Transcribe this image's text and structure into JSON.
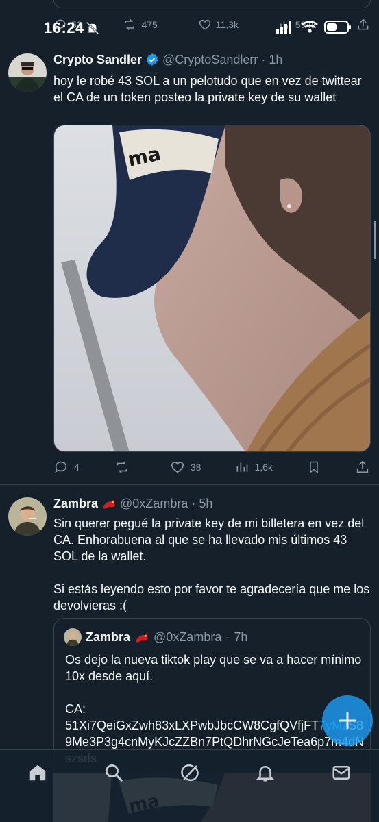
{
  "status_bar": {
    "time": "16:24"
  },
  "previous_tweet": {
    "reply_count": "52",
    "retweet_count": "475",
    "like_count": "11,3k",
    "view_count": "594k"
  },
  "tweet1": {
    "author_name": "Crypto Sandler",
    "handle": "@CryptoSandlerr",
    "time": "1h",
    "text": "hoy le robé 43 SOL a un pelotudo que en vez de twittear el CA de un token posteo la private key de su wallet",
    "replies": "4",
    "retweets": "",
    "likes": "38",
    "views": "1,6k"
  },
  "tweet2": {
    "author_name": "Zambra",
    "handle": "@0xZambra",
    "time": "5h",
    "text": "Sin querer pegué la private key de mi billetera en vez del CA. Enhorabuena al que se ha llevado mis últimos 43 SOL de la wallet.\n\nSi estás leyendo esto por favor te agradecería que me los devolvieras :(",
    "quote": {
      "author_name": "Zambra",
      "handle": "@0xZambra",
      "time": "7h",
      "text": "Os dejo la nueva tiktok play que se va a hacer mínimo 10x desde aquí.\n\nCA:\n",
      "ca_part1": "51Xi7QeiGxZwh83xLXPwbJbcCW8CgfQVfjFT",
      "ca_part2": "7yMz",
      "ca_part3": "S89Me3P3g4cnMyKJcZZBn7PtQDhrNGcJeTea6p7m4dNszsds"
    }
  },
  "colors": {
    "background": "#15202b",
    "accent": "#1d9bf0",
    "muted": "#8b98a5",
    "verified": "#1d9bf0",
    "divider": "#38444d"
  },
  "icons": {
    "bottom_nav": [
      "home-icon",
      "search-icon",
      "grok-icon",
      "notifications-icon",
      "messages-icon"
    ]
  }
}
